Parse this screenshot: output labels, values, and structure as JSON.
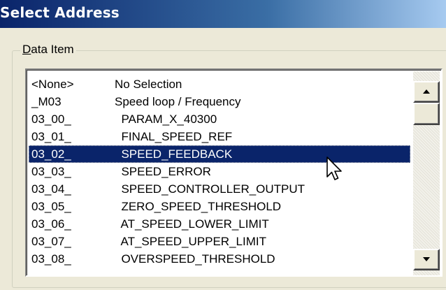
{
  "window": {
    "title": "Select Address"
  },
  "group": {
    "label_accel": "D",
    "label_rest": "ata Item"
  },
  "list": {
    "items": [
      {
        "code": "<None>",
        "desc": "No Selection"
      },
      {
        "code": "_M03",
        "desc": "Speed loop / Frequency"
      },
      {
        "code": "03_00_",
        "desc": "  PARAM_X_40300"
      },
      {
        "code": "03_01_",
        "desc": "  FINAL_SPEED_REF"
      },
      {
        "code": "03_02_",
        "desc": "  SPEED_FEEDBACK"
      },
      {
        "code": "03_03_",
        "desc": "  SPEED_ERROR"
      },
      {
        "code": "03_04_",
        "desc": "  SPEED_CONTROLLER_OUTPUT"
      },
      {
        "code": "03_05_",
        "desc": "  ZERO_SPEED_THRESHOLD"
      },
      {
        "code": "03_06_",
        "desc": "  AT_SPEED_LOWER_LIMIT"
      },
      {
        "code": "03_07_",
        "desc": "  AT_SPEED_UPPER_LIMIT"
      },
      {
        "code": "03_08_",
        "desc": "  OVERSPEED_THRESHOLD"
      }
    ],
    "selected_index": 4
  },
  "icons": {
    "scroll_up": "scroll-up-arrow-icon",
    "scroll_down": "scroll-down-arrow-icon",
    "cursor": "mouse-pointer-icon"
  },
  "colors": {
    "selection": "#0A246A",
    "title_gradient_start": "#0A246A",
    "dialog_bg": "#ECE9D8"
  }
}
